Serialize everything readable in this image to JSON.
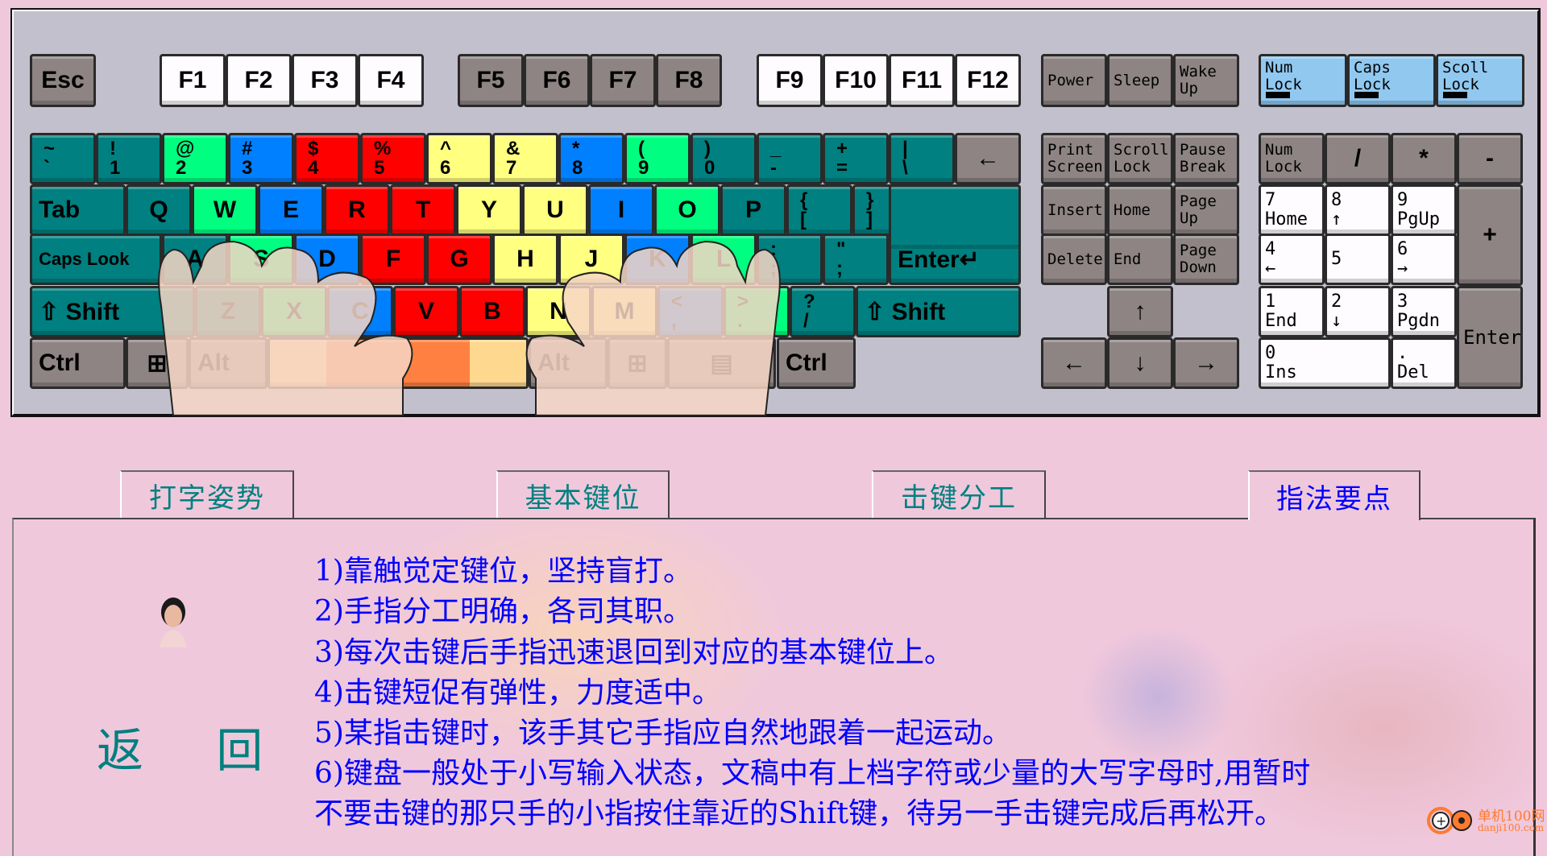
{
  "palette": {
    "teal": "#008080",
    "green": "#00ff80",
    "blue": "#0080ff",
    "red": "#ff0000",
    "yellow": "#ffff80",
    "gray": "#8e8484",
    "white": "#fffcff",
    "lightblue": "#90c8f0",
    "orange": "#ff8040",
    "sand": "#ffd890"
  },
  "keyboard": {
    "esc": {
      "label": "Esc",
      "color": "gray"
    },
    "f1_4": [
      {
        "label": "F1"
      },
      {
        "label": "F2"
      },
      {
        "label": "F3"
      },
      {
        "label": "F4"
      }
    ],
    "f5_8": [
      {
        "label": "F5"
      },
      {
        "label": "F6"
      },
      {
        "label": "F7"
      },
      {
        "label": "F8"
      }
    ],
    "f9_12": [
      {
        "label": "F9"
      },
      {
        "label": "F10"
      },
      {
        "label": "F11"
      },
      {
        "label": "F12"
      }
    ],
    "power": [
      {
        "label": "Power"
      },
      {
        "label": "Sleep"
      },
      {
        "label": "Wake\nUp"
      }
    ],
    "locks": [
      {
        "label": "Num\nLock"
      },
      {
        "label": "Caps\nLock"
      },
      {
        "label": "Scoll\nLock"
      }
    ],
    "rows": [
      [
        {
          "top": "~",
          "bottom": "`",
          "color": "teal"
        },
        {
          "top": "!",
          "bottom": "1",
          "color": "teal"
        },
        {
          "top": "@",
          "bottom": "2",
          "color": "green"
        },
        {
          "top": "#",
          "bottom": "3",
          "color": "blue"
        },
        {
          "top": "$",
          "bottom": "4",
          "color": "red"
        },
        {
          "top": "%",
          "bottom": "5",
          "color": "red"
        },
        {
          "top": "^",
          "bottom": "6",
          "color": "yellow"
        },
        {
          "top": "&",
          "bottom": "7",
          "color": "yellow"
        },
        {
          "top": "*",
          "bottom": "8",
          "color": "blue"
        },
        {
          "top": "(",
          "bottom": "9",
          "color": "green"
        },
        {
          "top": ")",
          "bottom": "0",
          "color": "teal"
        },
        {
          "top": "_",
          "bottom": "-",
          "color": "teal"
        },
        {
          "top": "+",
          "bottom": "=",
          "color": "teal"
        },
        {
          "top": "|",
          "bottom": "\\",
          "color": "teal"
        },
        {
          "label": "←",
          "color": "gray"
        }
      ],
      [
        {
          "label": "Tab",
          "color": "teal"
        },
        {
          "label": "Q",
          "color": "teal"
        },
        {
          "label": "W",
          "color": "green"
        },
        {
          "label": "E",
          "color": "blue"
        },
        {
          "label": "R",
          "color": "red"
        },
        {
          "label": "T",
          "color": "red"
        },
        {
          "label": "Y",
          "color": "yellow"
        },
        {
          "label": "U",
          "color": "yellow"
        },
        {
          "label": "I",
          "color": "blue"
        },
        {
          "label": "O",
          "color": "green"
        },
        {
          "label": "P",
          "color": "teal"
        },
        {
          "top": "{",
          "bottom": "[",
          "color": "teal"
        },
        {
          "top": "}",
          "bottom": "]",
          "color": "teal"
        }
      ],
      [
        {
          "label": "Caps Look",
          "color": "teal"
        },
        {
          "label": "A",
          "color": "teal"
        },
        {
          "label": "S",
          "color": "green"
        },
        {
          "label": "D",
          "color": "blue"
        },
        {
          "label": "F",
          "color": "red"
        },
        {
          "label": "G",
          "color": "red"
        },
        {
          "label": "H",
          "color": "yellow"
        },
        {
          "label": "J",
          "color": "yellow"
        },
        {
          "label": "K",
          "color": "blue"
        },
        {
          "label": "L",
          "color": "green"
        },
        {
          "top": ":",
          "bottom": ";",
          "color": "teal"
        },
        {
          "top": "\"",
          "bottom": ";",
          "color": "teal"
        },
        {
          "label": "Enter↵",
          "color": "teal"
        }
      ],
      [
        {
          "label": "⇧ Shift",
          "color": "teal"
        },
        {
          "label": "Z",
          "color": "teal"
        },
        {
          "label": "X",
          "color": "green"
        },
        {
          "label": "C",
          "color": "blue"
        },
        {
          "label": "V",
          "color": "red"
        },
        {
          "label": "B",
          "color": "red"
        },
        {
          "label": "N",
          "color": "yellow"
        },
        {
          "label": "M",
          "color": "yellow"
        },
        {
          "top": "<",
          "bottom": ",",
          "color": "blue"
        },
        {
          "top": ">",
          "bottom": ".",
          "color": "green"
        },
        {
          "top": "?",
          "bottom": "/",
          "color": "teal"
        },
        {
          "label": "⇧ Shift",
          "color": "teal"
        }
      ],
      [
        {
          "label": "Ctrl",
          "color": "gray"
        },
        {
          "label": "⊞",
          "color": "gray"
        },
        {
          "label": "Alt",
          "color": "gray"
        },
        {
          "label": "",
          "color": "orange"
        },
        {
          "label": "Alt",
          "color": "gray"
        },
        {
          "label": "⊞",
          "color": "gray"
        },
        {
          "label": "▤",
          "color": "gray"
        },
        {
          "label": "Ctrl",
          "color": "gray"
        }
      ]
    ],
    "nav": [
      [
        {
          "label": "Print\nScreen"
        },
        {
          "label": "Scroll\nLock"
        },
        {
          "label": "Pause\nBreak"
        }
      ],
      [
        {
          "label": "Insert"
        },
        {
          "label": "Home"
        },
        {
          "label": "Page\nUp"
        }
      ],
      [
        {
          "label": "Delete"
        },
        {
          "label": "End"
        },
        {
          "label": "Page\nDown"
        }
      ]
    ],
    "arrows": {
      "up": "↑",
      "left": "←",
      "down": "↓",
      "right": "→"
    },
    "numpad": {
      "row1": [
        {
          "label": "Num\nLock"
        },
        {
          "label": "/"
        },
        {
          "label": "*"
        },
        {
          "label": "-"
        }
      ],
      "row2": [
        {
          "label": "7\nHome"
        },
        {
          "label": "8\n↑"
        },
        {
          "label": "9\nPgUp"
        }
      ],
      "row3": [
        {
          "label": "4\n←"
        },
        {
          "label": "5"
        },
        {
          "label": "6\n→"
        }
      ],
      "row4": [
        {
          "label": "1\nEnd"
        },
        {
          "label": "2\n↓"
        },
        {
          "label": "3\nPgdn"
        }
      ],
      "zero": {
        "label": "0\nIns"
      },
      "dot": {
        "label": ".\nDel"
      },
      "plus": {
        "label": "+"
      },
      "enter": {
        "label": "Enter"
      }
    }
  },
  "tabs": [
    {
      "label": "打字姿势",
      "active": false
    },
    {
      "label": "基本键位",
      "active": false
    },
    {
      "label": "击键分工",
      "active": false
    },
    {
      "label": "指法要点",
      "active": true
    }
  ],
  "content": {
    "lines": [
      "1)靠触觉定键位，坚持盲打。",
      "2)手指分工明确，各司其职。",
      "3)每次击键后手指迅速退回到对应的基本键位上。",
      "4)击键短促有弹性，力度适中。",
      "5)某指击键时，该手其它手指应自然地跟着一起运动。",
      "6)键盘一般处于小写输入状态，文稿中有上档字符或少量的大写字母时,用暂时",
      "不要击键的那只手的小指按住靠近的Shift键，待另一手击键完成后再松开。"
    ],
    "back_label": "返 回"
  },
  "watermark": {
    "name": "单机100网",
    "url": "danji100.com"
  }
}
